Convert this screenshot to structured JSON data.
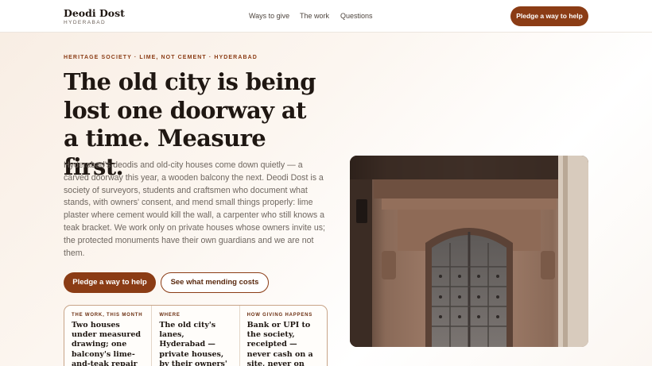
{
  "brand": {
    "name": "Deodi Dost",
    "city": "HYDERABAD"
  },
  "nav": {
    "items": [
      "Ways to give",
      "The work",
      "Questions"
    ],
    "cta": "Pledge a way to help"
  },
  "hero": {
    "eyebrow": "HERITAGE SOCIETY · LIME, NOT CEMENT · HYDERABAD",
    "headline": "The old city is being lost one doorway at a time. Measure first.",
    "body": "Hyderabad's deodis and old-city houses come down quietly — a carved doorway this year, a wooden balcony the next. Deodi Dost is a society of surveyors, students and craftsmen who document what stands, with owners' consent, and mend small things properly: lime plaster where cement would kill the wall, a carpenter who still knows a teak bracket. We work only on private houses whose owners invite us; the protected monuments have their own guardians and we are not them.",
    "primary_button": "Pledge a way to help",
    "secondary_button": "See what mending costs"
  },
  "cards": [
    {
      "label": "THE WORK, THIS MONTH",
      "text": "Two houses under measured drawing; one balcony's lime-and-teak repair underway"
    },
    {
      "label": "WHERE",
      "text": "The old city's lanes, Hyderabad — private houses, by their owners' invitation only"
    },
    {
      "label": "HOW GIVING HAPPENS",
      "text": "Bank or UPI to the society, receipted — never cash on a site, never on this page"
    }
  ],
  "photo": {
    "subject": "carved wooden doorway of an old-city house"
  },
  "colors": {
    "accent": "#8b3c15",
    "text": "#1f1712",
    "muted": "#6f6760"
  }
}
